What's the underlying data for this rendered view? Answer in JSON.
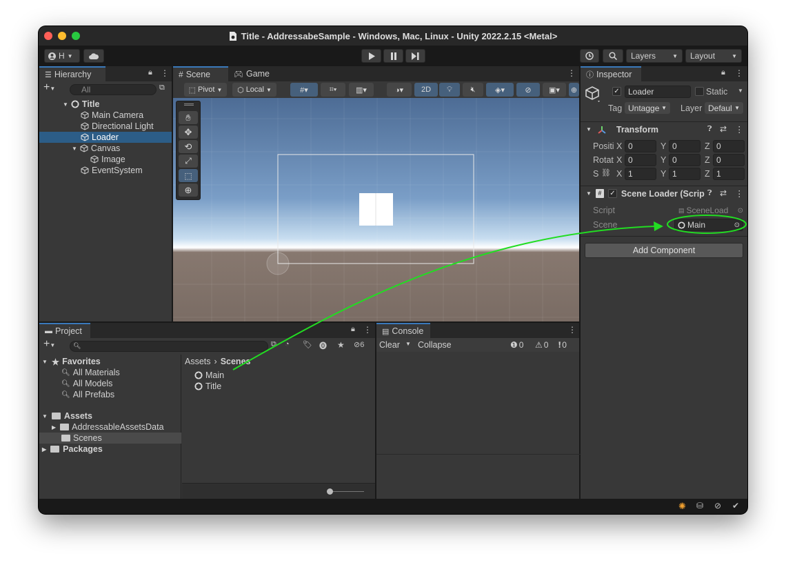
{
  "window_title": "Title - AddressabeSample - Windows, Mac, Linux - Unity 2022.2.15 <Metal>",
  "toolbar": {
    "account_label": "H",
    "layers_label": "Layers",
    "layout_label": "Layout"
  },
  "hierarchy": {
    "tab_label": "Hierarchy",
    "search_placeholder": "All",
    "scene_name": "Title",
    "items": [
      "Main Camera",
      "Directional Light",
      "Loader",
      "Canvas",
      "Image",
      "EventSystem"
    ],
    "selected": "Loader"
  },
  "scene_view": {
    "tabs": [
      "Scene",
      "Game"
    ],
    "pivot_label": "Pivot",
    "local_label": "Local",
    "mode_2d_label": "2D"
  },
  "inspector": {
    "tab_label": "Inspector",
    "object_name": "Loader",
    "static_label": "Static",
    "tag_label": "Tag",
    "tag_value": "Untagge",
    "layer_label": "Layer",
    "layer_value": "Defaul",
    "transform": {
      "title": "Transform",
      "position_label": "Positi",
      "rotation_label": "Rotat",
      "scale_label": "S",
      "position": [
        "0",
        "0",
        "0"
      ],
      "rotation": [
        "0",
        "0",
        "0"
      ],
      "scale": [
        "1",
        "1",
        "1"
      ],
      "axis_x": "X",
      "axis_y": "Y",
      "axis_z": "Z"
    },
    "scene_loader": {
      "title": "Scene Loader (Scrip",
      "script_label": "Script",
      "script_value": "SceneLoad",
      "scene_label": "Scene",
      "scene_value": "Main"
    },
    "add_component_label": "Add Component"
  },
  "project": {
    "tab_label": "Project",
    "hidden_count": "6",
    "favorites_label": "Favorites",
    "favorites": [
      "All Materials",
      "All Models",
      "All Prefabs"
    ],
    "assets_label": "Assets",
    "asset_folders": [
      "AddressableAssetsData",
      "Scenes"
    ],
    "packages_label": "Packages",
    "breadcrumb": [
      "Assets",
      "Scenes"
    ],
    "files": [
      "Main",
      "Title"
    ]
  },
  "console": {
    "tab_label": "Console",
    "clear_label": "Clear",
    "collapse_label": "Collapse",
    "log_count": "0",
    "warning_count": "0",
    "error_count": "0"
  },
  "colors": {
    "accent": "#3a79bb",
    "selection": "#2c5d87",
    "annotation_green": "#22dd22"
  }
}
